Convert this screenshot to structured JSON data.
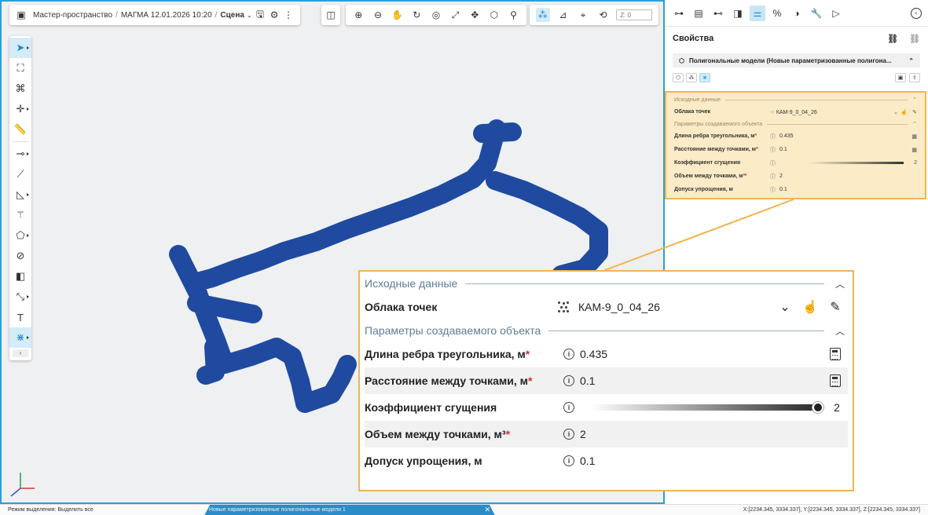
{
  "topbar": {
    "breadcrumb_root": "Мастер-пространство",
    "breadcrumb_project": "МАГМА 12.01.2026 10:20",
    "scene_menu": "Сцена",
    "z_placeholder": "Z: 0"
  },
  "properties": {
    "title": "Свойства",
    "model_name": "Полигональные модели (Новые параметризованные полигона..."
  },
  "form": {
    "section_source": "Исходные данные",
    "point_clouds_label": "Облака точек",
    "point_clouds_value": "КАМ-9_0_04_26",
    "section_params": "Параметры создаваемого объекта",
    "fields": [
      {
        "label": "Длина ребра треугольника, м",
        "value": "0.435"
      },
      {
        "label": "Расстояние между точками, м",
        "value": "0.1"
      },
      {
        "label": "Коэффициент сгущения",
        "value": "2"
      },
      {
        "label": "Объем между точками, м³",
        "value": "2"
      },
      {
        "label": "Допуск упрощения, м",
        "value": "0.1"
      }
    ],
    "required_mark": "*",
    "info_glyph": "i",
    "density_level": 1.0
  },
  "status": {
    "mode": "Режим выделения: Выделить все",
    "tab": "Новые параметризованные полигональные модели 1",
    "coords": "X:[2234.345, 3334.337], Y:[2234.345, 3334.337], Z:[2234.345, 3334.337]"
  },
  "colors": {
    "accent": "#29a0d8",
    "tunnel": "#1f4aa0",
    "highlight": "#f2b450",
    "required": "#d0303a"
  }
}
